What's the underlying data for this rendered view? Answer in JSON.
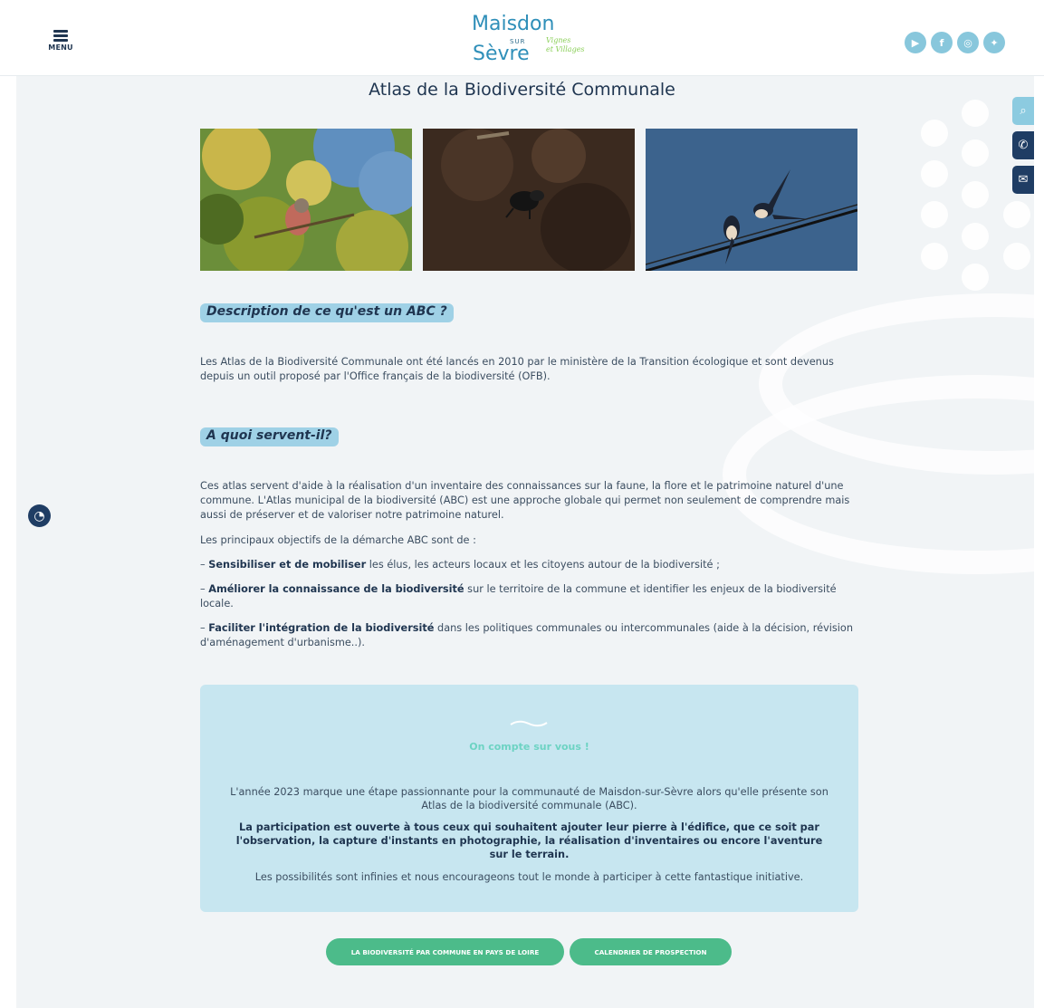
{
  "header": {
    "menu_label": "MENU",
    "logo": {
      "line1": "Maisdon",
      "line2": "SUR",
      "line3": "Sèvre",
      "tagline1": "Vignes",
      "tagline2": "et Villages"
    },
    "socials": [
      {
        "name": "youtube-icon",
        "glyph": "▶"
      },
      {
        "name": "facebook-icon",
        "glyph": "f"
      },
      {
        "name": "instagram-icon",
        "glyph": "◎"
      },
      {
        "name": "twitter-icon",
        "glyph": "✦"
      }
    ]
  },
  "side_tools": {
    "search_glyph": "⌕",
    "phone_glyph": "✆",
    "mail_glyph": "✉"
  },
  "cookie_glyph": "◔",
  "page": {
    "title": "Atlas de la Biodiversité Communale"
  },
  "section1": {
    "heading": "Description de ce qu'est un ABC ?",
    "text": "Les Atlas de la Biodiversité Communale ont été lancés en 2010 par le ministère de la Transition écologique et sont devenus depuis un outil proposé par l'Office français de la biodiversité (OFB)."
  },
  "section2": {
    "heading": "A quoi servent-il?",
    "intro": "Ces atlas servent d'aide à la réalisation d'un inventaire des connaissances sur la faune, la flore et le patrimoine naturel d'une commune. L'Atlas municipal de la biodiversité (ABC) est une approche globale qui permet non seulement de comprendre mais aussi de préserver et de valoriser notre patrimoine naturel.",
    "objectives_intro": "Les principaux objectifs de la démarche ABC sont de :",
    "objectives": [
      {
        "prefix": "– ",
        "bold": "Sensibiliser et de mobiliser",
        "rest": " les élus, les acteurs locaux et les citoyens autour de la biodiversité ;"
      },
      {
        "prefix": "– ",
        "bold": "Améliorer la connaissance de la biodiversité",
        "rest": " sur le territoire de la commune et identifier les enjeux de la biodiversité locale."
      },
      {
        "prefix": "– ",
        "bold": "Faciliter l'intégration de la biodiversité",
        "rest": " dans les politiques communales ou intercommunales (aide à la décision, révision d'aménagement d'urbanisme..)."
      }
    ]
  },
  "callout": {
    "tag": "On compte sur vous !",
    "p1": "L'année 2023 marque une étape passionnante pour la communauté de Maisdon-sur-Sèvre alors qu'elle présente son Atlas de la biodiversité communale (ABC).",
    "p2": "La participation est ouverte à tous ceux qui souhaitent ajouter leur pierre à l'édifice, que ce soit par l'observation, la capture d'instants en photographie, la réalisation d'inventaires ou encore l'aventure sur le terrain.",
    "p3": "Les possibilités sont infinies et nous encourageons tout le monde à participer à cette fantastique initiative."
  },
  "buttons": {
    "biodiversity": "LA BIODIVERSITÉ PAR COMMUNE EN PAYS DE LOIRE",
    "calendar": "CALENDRIER DE PROSPECTION"
  },
  "colors": {
    "navy": "#1f3550",
    "accent_blue": "#9fd1e6",
    "callout_bg": "#c7e6f0",
    "button_green": "#4cbb8a",
    "social_blue": "#88c7dc"
  }
}
